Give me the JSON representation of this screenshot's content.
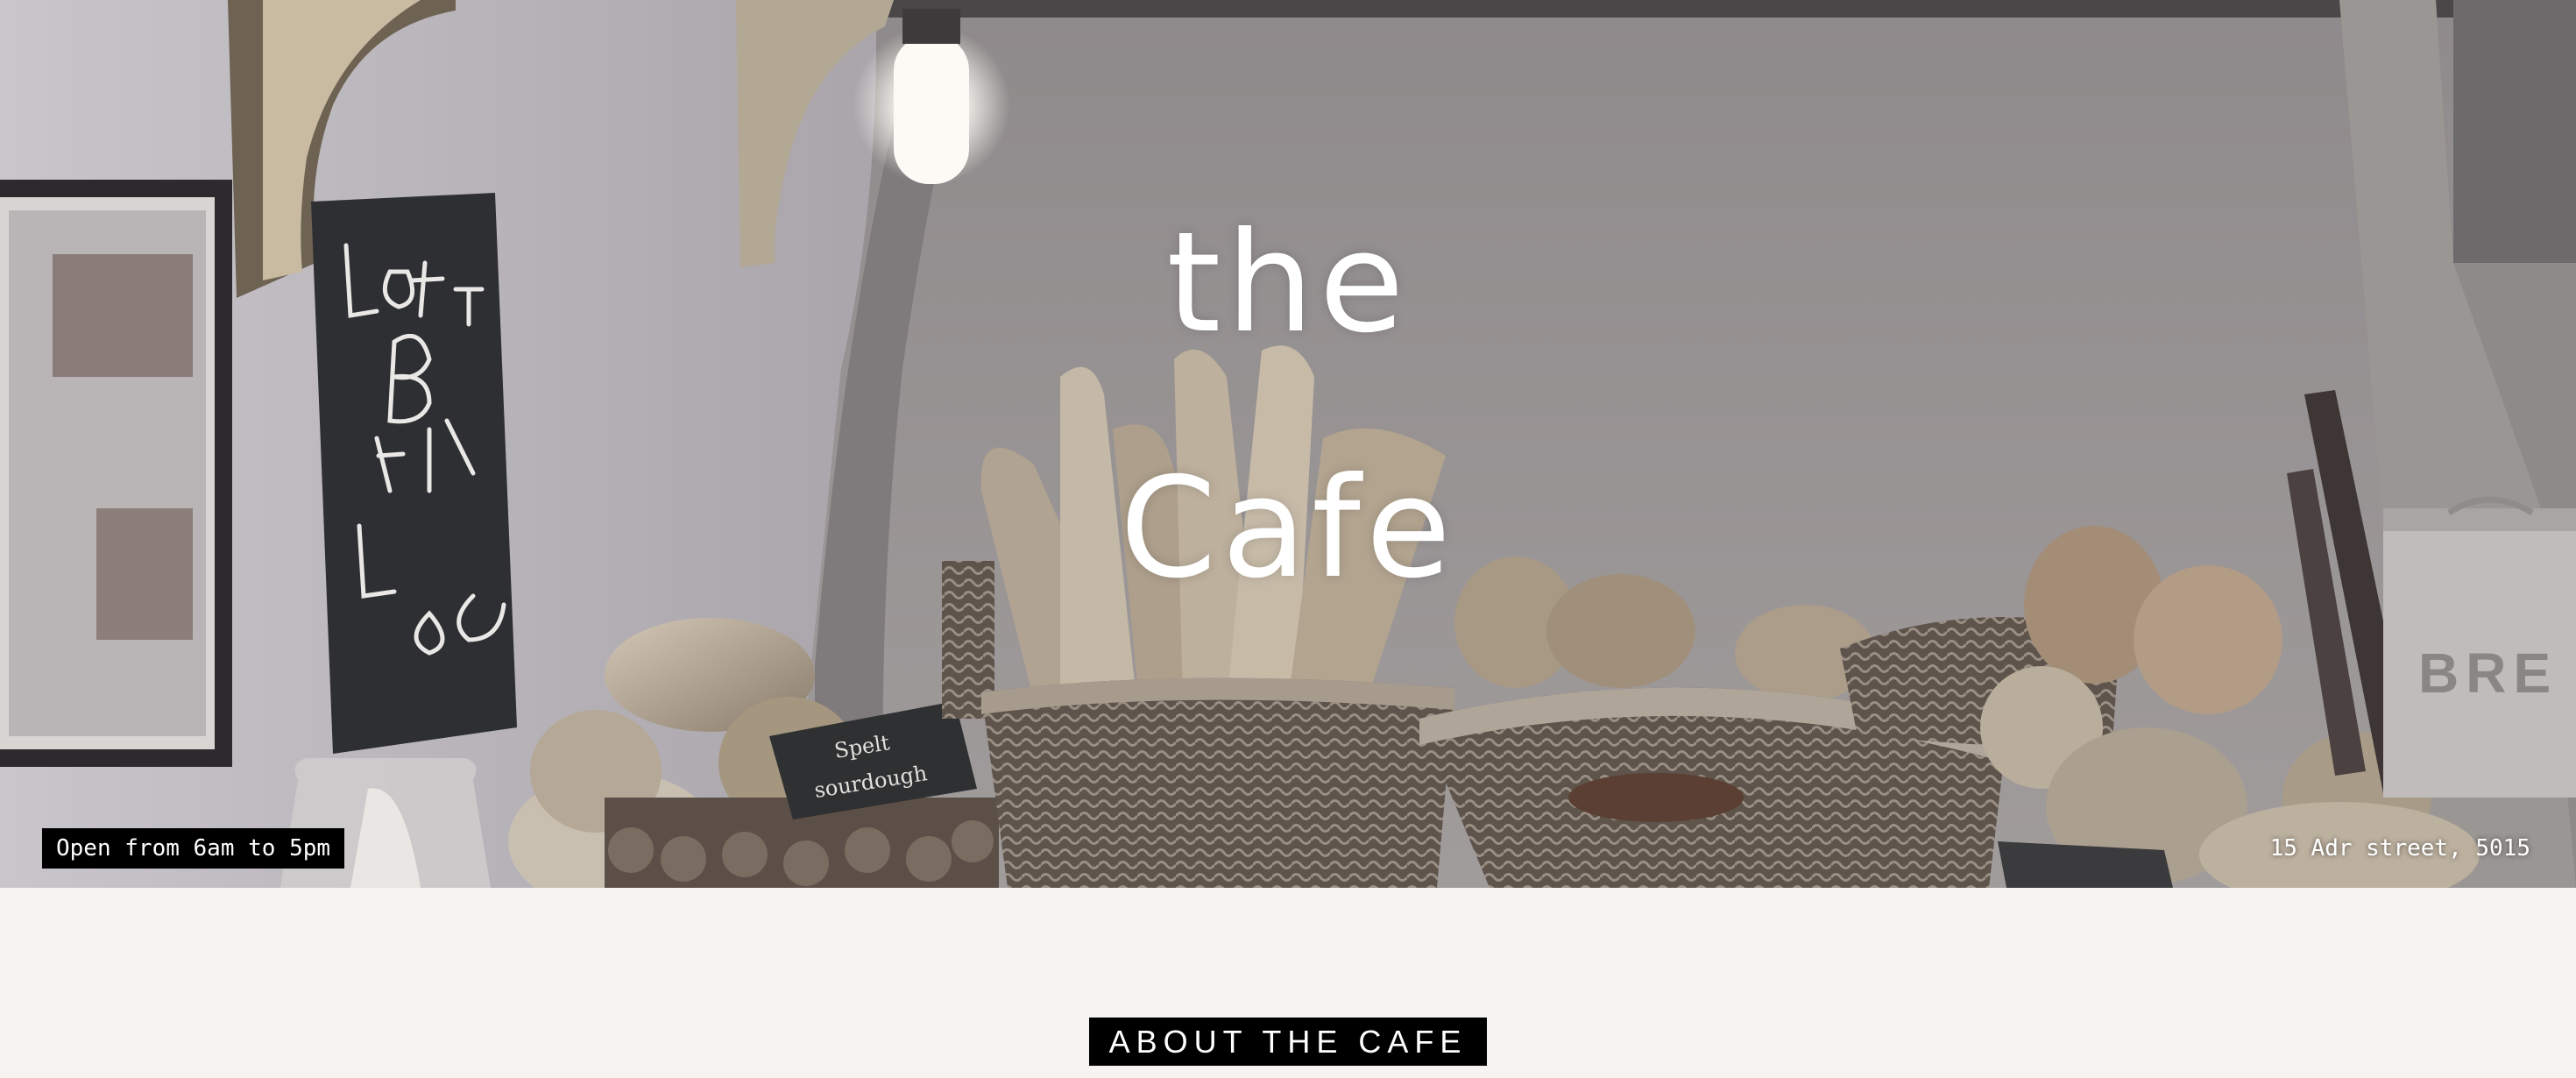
{
  "hero": {
    "title_line1": "the",
    "title_line2": "Cafe",
    "hours": "Open from 6am to 5pm",
    "address": "15 Adr street, 5015"
  },
  "about": {
    "heading": "ABOUT THE CAFE"
  },
  "photo": {
    "chalkboard_lines": [
      "LoaF Too",
      "Big",
      "Any ½",
      "LoaF €2"
    ],
    "sign_text": [
      "Spelt",
      "sourdough"
    ],
    "bin_label": "BRE"
  },
  "colors": {
    "background": "#f5f4f0",
    "badge": "#000000",
    "badge_text": "#ffffff"
  }
}
